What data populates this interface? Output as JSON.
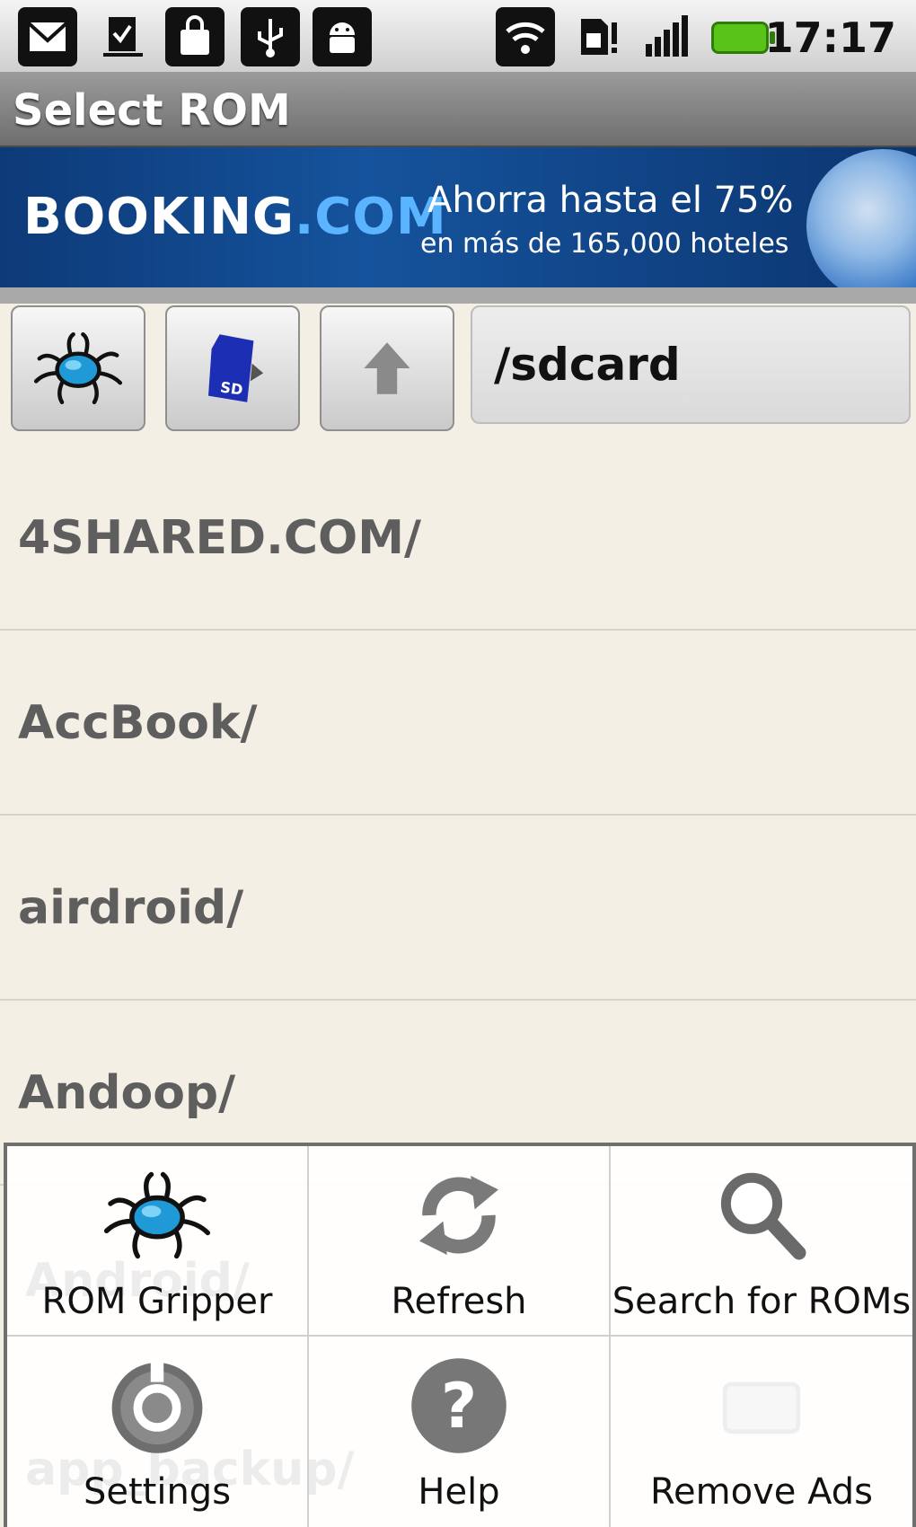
{
  "status_bar": {
    "time": "17:17",
    "icons": [
      "gmail-icon",
      "download-done-icon",
      "market-bag-icon",
      "usb-icon",
      "android-debug-icon",
      "wifi-icon",
      "sim-alert-icon",
      "signal-icon",
      "battery-icon"
    ]
  },
  "title": "Select ROM",
  "ad": {
    "brand": "BOOKING",
    "brand_suffix": ".COM",
    "line1": "Ahorra hasta el 75%",
    "line2": "en más de 165,000 hoteles"
  },
  "toolbar": {
    "path": "/sdcard"
  },
  "files": [
    {
      "label": "4SHARED.COM/"
    },
    {
      "label": "AccBook/"
    },
    {
      "label": "airdroid/"
    },
    {
      "label": "Andoop/"
    }
  ],
  "hidden_behind_menu": [
    "Android/",
    "app_backup/"
  ],
  "menu": [
    {
      "label": "ROM Gripper",
      "icon": "rom-gripper-icon"
    },
    {
      "label": "Refresh",
      "icon": "refresh-icon"
    },
    {
      "label": "Search for ROMs",
      "icon": "search-icon"
    },
    {
      "label": "Settings",
      "icon": "settings-icon"
    },
    {
      "label": "Help",
      "icon": "help-icon"
    },
    {
      "label": "Remove Ads",
      "icon": "remove-ads-icon"
    }
  ],
  "colors": {
    "list_background": "#f3efe4",
    "title_bar": "#7e7e7e",
    "banner": "#0d3a78",
    "battery": "#5ac31a"
  }
}
